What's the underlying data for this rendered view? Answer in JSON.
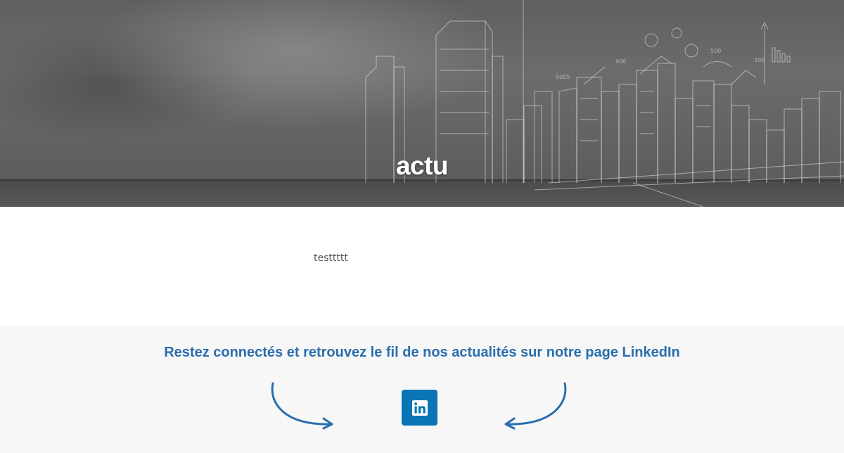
{
  "hero": {
    "title": "actu"
  },
  "post": {
    "body": "testtttt"
  },
  "cta": {
    "heading": "Restez connectés et retrouvez le fil de nos actualités sur notre page LinkedIn",
    "linkedin_icon": "linkedin-icon",
    "left_arrow_icon": "curved-arrow-right-icon",
    "right_arrow_icon": "curved-arrow-left-icon"
  },
  "colors": {
    "accent_blue": "#2a6eae",
    "linkedin_blue": "#0a75b5",
    "cta_background": "#f7f7f7"
  }
}
